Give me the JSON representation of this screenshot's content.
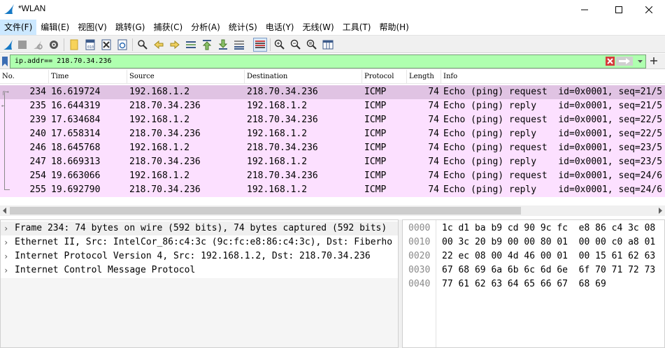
{
  "window": {
    "title": "*WLAN",
    "controls": [
      "minimize-icon",
      "maximize-icon",
      "close-icon"
    ]
  },
  "menu": [
    {
      "label": "文件(F)",
      "active": true
    },
    {
      "label": "编辑(E)"
    },
    {
      "label": "视图(V)"
    },
    {
      "label": "跳转(G)"
    },
    {
      "label": "捕获(C)"
    },
    {
      "label": "分析(A)"
    },
    {
      "label": "统计(S)"
    },
    {
      "label": "电话(Y)"
    },
    {
      "label": "无线(W)"
    },
    {
      "label": "工具(T)"
    },
    {
      "label": "帮助(H)"
    }
  ],
  "toolbar": {
    "icons": [
      "shark-fin-start-icon",
      "stop-icon",
      "restart-icon",
      "capture-options-icon",
      "open-file-icon",
      "save-file-icon",
      "close-file-icon",
      "reload-icon",
      "find-packet-icon",
      "go-back-icon",
      "go-forward-icon",
      "go-to-packet-icon",
      "first-packet-icon",
      "last-packet-icon",
      "autoscroll-icon",
      "colorize-icon",
      "zoom-in-icon",
      "zoom-out-icon",
      "normal-size-icon",
      "resize-columns-icon"
    ]
  },
  "filter": {
    "value": "ip.addr== 218.70.34.236",
    "colors": {
      "valid_bg": "#afffaf"
    }
  },
  "packet_list": {
    "columns": [
      "No.",
      "Time",
      "Source",
      "Destination",
      "Protocol",
      "Length",
      "Info"
    ],
    "rows": [
      {
        "no": "234",
        "time": "16.619724",
        "source": "192.168.1.2",
        "destination": "218.70.34.236",
        "protocol": "ICMP",
        "length": "74",
        "info": "Echo (ping) request  id=0x0001, seq=21/5",
        "selected": true
      },
      {
        "no": "235",
        "time": "16.644319",
        "source": "218.70.34.236",
        "destination": "192.168.1.2",
        "protocol": "ICMP",
        "length": "74",
        "info": "Echo (ping) reply    id=0x0001, seq=21/5"
      },
      {
        "no": "239",
        "time": "17.634684",
        "source": "192.168.1.2",
        "destination": "218.70.34.236",
        "protocol": "ICMP",
        "length": "74",
        "info": "Echo (ping) request  id=0x0001, seq=22/5"
      },
      {
        "no": "240",
        "time": "17.658314",
        "source": "218.70.34.236",
        "destination": "192.168.1.2",
        "protocol": "ICMP",
        "length": "74",
        "info": "Echo (ping) reply    id=0x0001, seq=22/5"
      },
      {
        "no": "246",
        "time": "18.645768",
        "source": "192.168.1.2",
        "destination": "218.70.34.236",
        "protocol": "ICMP",
        "length": "74",
        "info": "Echo (ping) request  id=0x0001, seq=23/5"
      },
      {
        "no": "247",
        "time": "18.669313",
        "source": "218.70.34.236",
        "destination": "192.168.1.2",
        "protocol": "ICMP",
        "length": "74",
        "info": "Echo (ping) reply    id=0x0001, seq=23/5"
      },
      {
        "no": "254",
        "time": "19.663066",
        "source": "192.168.1.2",
        "destination": "218.70.34.236",
        "protocol": "ICMP",
        "length": "74",
        "info": "Echo (ping) request  id=0x0001, seq=24/6"
      },
      {
        "no": "255",
        "time": "19.692790",
        "source": "218.70.34.236",
        "destination": "192.168.1.2",
        "protocol": "ICMP",
        "length": "74",
        "info": "Echo (ping) reply    id=0x0001, seq=24/6"
      }
    ],
    "colors": {
      "row_bg": "#fce0ff",
      "selected_bg": "#e0c3e3"
    }
  },
  "details": [
    "Frame 234: 74 bytes on wire (592 bits), 74 bytes captured (592 bits)",
    "Ethernet II, Src: IntelCor_86:c4:3c (9c:fc:e8:86:c4:3c), Dst: Fiberho",
    "Internet Protocol Version 4, Src: 192.168.1.2, Dst: 218.70.34.236",
    "Internet Control Message Protocol"
  ],
  "bytes": [
    {
      "offset": "0000",
      "hex": "1c d1 ba b9 cd 90 9c fc  e8 86 c4 3c 08"
    },
    {
      "offset": "0010",
      "hex": "00 3c 20 b9 00 00 80 01  00 00 c0 a8 01"
    },
    {
      "offset": "0020",
      "hex": "22 ec 08 00 4d 46 00 01  00 15 61 62 63"
    },
    {
      "offset": "0030",
      "hex": "67 68 69 6a 6b 6c 6d 6e  6f 70 71 72 73"
    },
    {
      "offset": "0040",
      "hex": "77 61 62 63 64 65 66 67  68 69"
    }
  ]
}
